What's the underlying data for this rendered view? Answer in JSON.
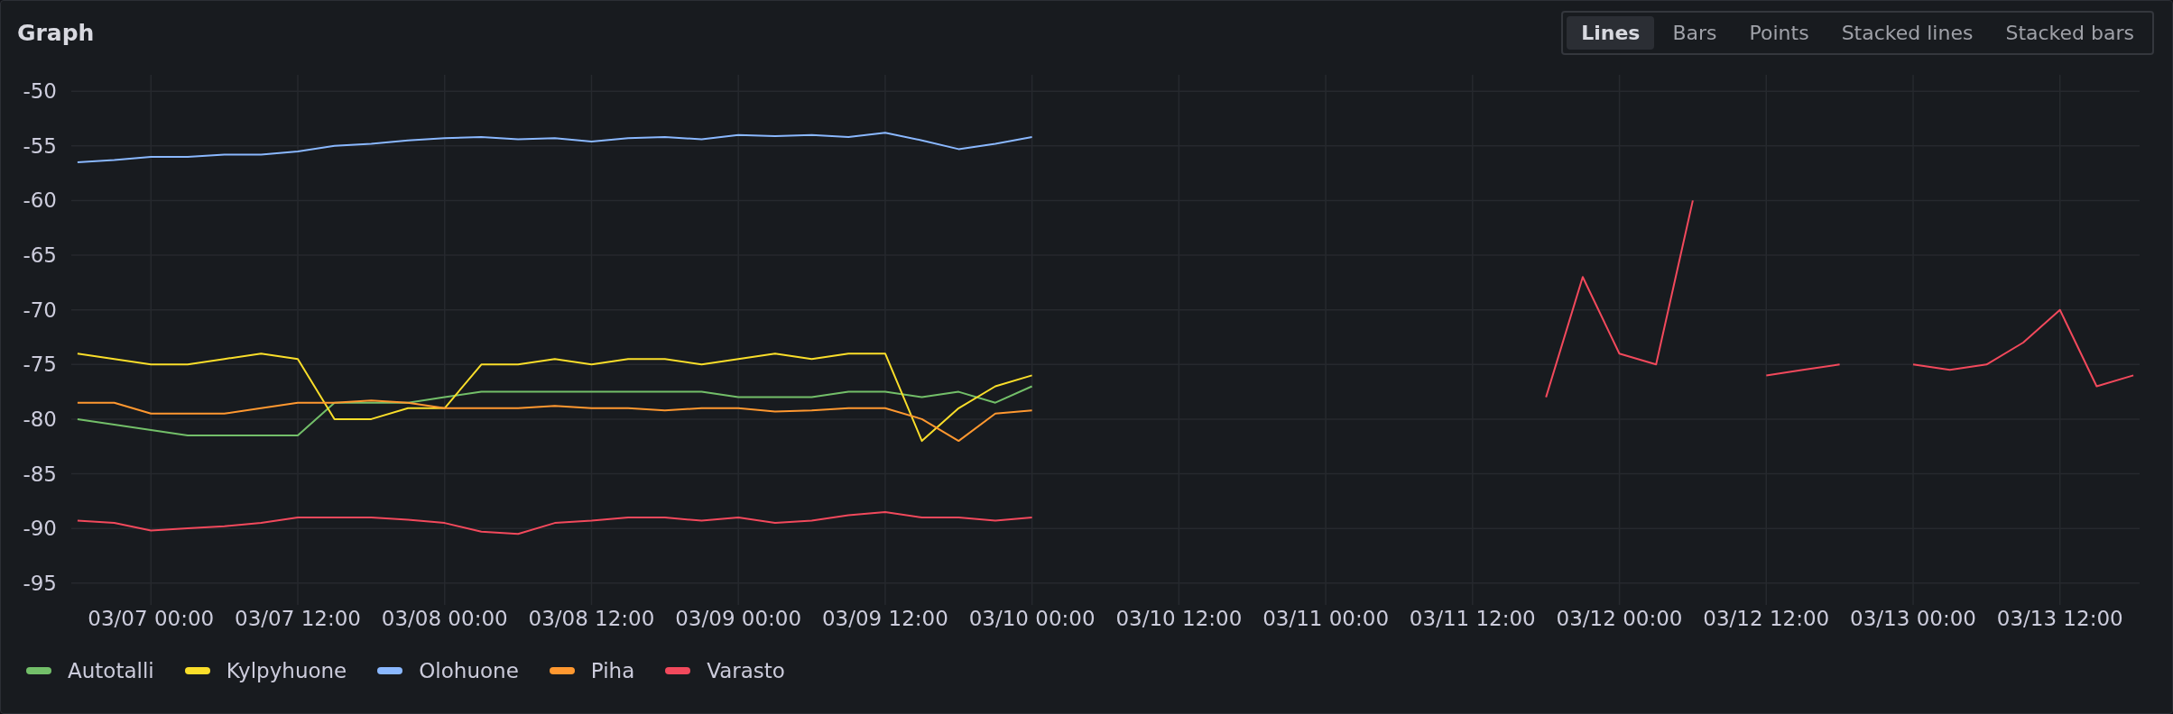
{
  "panel": {
    "title": "Graph"
  },
  "view_modes": [
    {
      "label": "Lines",
      "selected": true
    },
    {
      "label": "Bars",
      "selected": false
    },
    {
      "label": "Points",
      "selected": false
    },
    {
      "label": "Stacked lines",
      "selected": false
    },
    {
      "label": "Stacked bars",
      "selected": false
    }
  ],
  "chart_data": {
    "type": "line",
    "categories": [
      null,
      null,
      "03/07 00:00",
      null,
      null,
      null,
      "03/07 12:00",
      null,
      null,
      null,
      "03/08 00:00",
      null,
      null,
      null,
      "03/08 12:00",
      null,
      null,
      null,
      "03/09 00:00",
      null,
      null,
      null,
      "03/09 12:00",
      null,
      null,
      null,
      "03/10 00:00",
      null,
      null,
      null,
      "03/10 12:00",
      null,
      null,
      null,
      "03/11 00:00",
      null,
      null,
      null,
      "03/11 12:00",
      null,
      null,
      null,
      "03/12 00:00",
      null,
      null,
      null,
      "03/12 12:00",
      null,
      null,
      null,
      "03/13 00:00",
      null,
      null,
      null,
      "03/13 12:00",
      null,
      null
    ],
    "ylim": [
      -97,
      -48.5
    ],
    "grid": true,
    "yticks": [
      -95,
      -90,
      -85,
      -80,
      -75,
      -70,
      -65,
      -60,
      -55,
      -50
    ],
    "series": [
      {
        "name": "Autotalli",
        "color": "#73bf69",
        "values": [
          -80,
          -80.5,
          -81,
          -81.5,
          -81.5,
          -81.5,
          -81.5,
          -78.5,
          -78.5,
          -78.5,
          -78,
          -77.5,
          -77.5,
          -77.5,
          -77.5,
          -77.5,
          -77.5,
          -77.5,
          -78,
          -78,
          -78,
          -77.5,
          -77.5,
          -78,
          -77.5,
          -78.5,
          -77,
          null,
          null,
          null,
          null,
          null,
          null,
          null,
          null,
          null,
          null,
          null,
          null,
          null,
          null,
          null,
          null,
          null,
          null,
          null,
          null,
          null,
          null,
          null,
          null,
          null,
          null,
          null,
          null,
          null,
          null
        ]
      },
      {
        "name": "Kylpyhuone",
        "color": "#fade2a",
        "values": [
          -74,
          -74.5,
          -75,
          -75,
          -74.5,
          -74,
          -74.5,
          -80,
          -80,
          -79,
          -79,
          -75,
          -75,
          -74.5,
          -75,
          -74.5,
          -74.5,
          -75,
          -74.5,
          -74,
          -74.5,
          -74,
          -74,
          -82,
          -79,
          -77,
          -76,
          null,
          null,
          null,
          null,
          null,
          null,
          null,
          null,
          null,
          null,
          null,
          null,
          null,
          null,
          null,
          null,
          null,
          null,
          null,
          null,
          null,
          null,
          null,
          null,
          null,
          null,
          null,
          null,
          null,
          null
        ]
      },
      {
        "name": "Olohuone",
        "color": "#8ab8ff",
        "values": [
          -56.5,
          -56.3,
          -56,
          -56,
          -55.8,
          -55.8,
          -55.5,
          -55,
          -54.8,
          -54.5,
          -54.3,
          -54.2,
          -54.4,
          -54.3,
          -54.6,
          -54.3,
          -54.2,
          -54.4,
          -54,
          -54.1,
          -54,
          -54.2,
          -53.8,
          -54.5,
          -55.3,
          -54.8,
          -54.2,
          null,
          null,
          null,
          null,
          null,
          null,
          null,
          null,
          null,
          null,
          null,
          null,
          null,
          null,
          null,
          null,
          null,
          null,
          null,
          null,
          null,
          null,
          null,
          null,
          null,
          null,
          null,
          null,
          null,
          null
        ]
      },
      {
        "name": "Piha",
        "color": "#ff9830",
        "values": [
          -78.5,
          -78.5,
          -79.5,
          -79.5,
          -79.5,
          -79,
          -78.5,
          -78.5,
          -78.3,
          -78.5,
          -79,
          -79,
          -79,
          -78.8,
          -79,
          -79,
          -79.2,
          -79,
          -79,
          -79.3,
          -79.2,
          -79,
          -79,
          -80,
          -82,
          -79.5,
          -79.2,
          null,
          null,
          null,
          null,
          null,
          null,
          null,
          null,
          null,
          null,
          null,
          null,
          null,
          null,
          null,
          null,
          null,
          null,
          null,
          null,
          null,
          null,
          null,
          null,
          null,
          null,
          null,
          null,
          null,
          null
        ]
      },
      {
        "name": "Varasto",
        "color": "#f2495c",
        "values": [
          -89.3,
          -89.5,
          -90.2,
          -90,
          -89.8,
          -89.5,
          -89,
          -89,
          -89,
          -89.2,
          -89.5,
          -90.3,
          -90.5,
          -89.5,
          -89.3,
          -89,
          -89,
          -89.3,
          -89,
          -89.5,
          -89.3,
          -88.8,
          -88.5,
          -89,
          -89,
          -89.3,
          -89,
          null,
          null,
          null,
          null,
          null,
          null,
          null,
          null,
          null,
          null,
          null,
          null,
          null,
          -78,
          -67,
          -74,
          -75,
          -60,
          null,
          -76,
          -75.5,
          -75,
          null,
          -75,
          -75.5,
          -75,
          -73,
          -70,
          -77,
          -76
        ]
      }
    ]
  }
}
